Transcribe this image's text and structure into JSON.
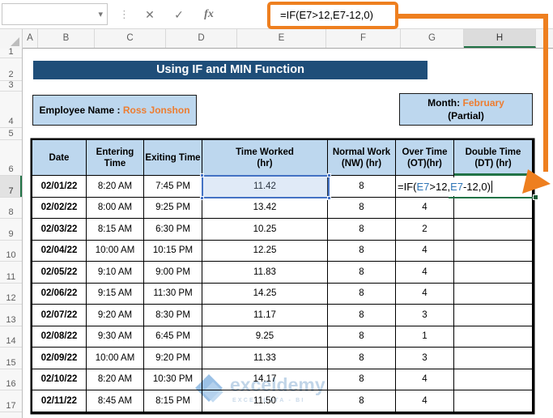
{
  "formula_bar": {
    "name_box_value": "",
    "dropdown_icon": "▾",
    "separator_icon": "⋮",
    "cancel_icon": "✕",
    "enter_icon": "✓",
    "fx_icon": "fx",
    "formula": "=IF(E7>12,E7-12,0)"
  },
  "sheet": {
    "column_letters": [
      "A",
      "B",
      "C",
      "D",
      "E",
      "F",
      "G",
      "H"
    ],
    "active_column": "H",
    "row_numbers": [
      "1",
      "2",
      "3",
      "4",
      "5",
      "6",
      "7",
      "8",
      "9",
      "10",
      "11",
      "12",
      "13",
      "14",
      "15",
      "16",
      "17"
    ],
    "active_row": "7"
  },
  "banner": {
    "title": "Using IF and MIN Function"
  },
  "employee_box": {
    "label": "Employee Name :",
    "value": "Ross Jonshon"
  },
  "month_box": {
    "label": "Month:",
    "value": "February",
    "line2": "(Partial)"
  },
  "table": {
    "headers": [
      "Date",
      "Entering\nTime",
      "Exiting Time",
      "Time Worked\n(hr)",
      "Normal Work\n(NW) (hr)",
      "Over Time\n(OT)(hr)",
      "Double Time\n(DT) (hr)"
    ],
    "rows": [
      [
        "02/01/22",
        "8:20 AM",
        "7:45 PM",
        "11.42",
        "8",
        "",
        ""
      ],
      [
        "02/02/22",
        "8:00 AM",
        "9:25 PM",
        "13.42",
        "8",
        "4",
        ""
      ],
      [
        "02/03/22",
        "8:15 AM",
        "6:30 PM",
        "10.25",
        "8",
        "2",
        ""
      ],
      [
        "02/04/22",
        "10:00 AM",
        "10:15 PM",
        "12.25",
        "8",
        "4",
        ""
      ],
      [
        "02/05/22",
        "9:10 AM",
        "9:00 PM",
        "11.83",
        "8",
        "4",
        ""
      ],
      [
        "02/06/22",
        "9:15 AM",
        "11:30 PM",
        "14.25",
        "8",
        "4",
        ""
      ],
      [
        "02/07/22",
        "9:20 AM",
        "8:30 PM",
        "11.17",
        "8",
        "3",
        ""
      ],
      [
        "02/08/22",
        "9:30 AM",
        "6:45 PM",
        "9.25",
        "8",
        "1",
        ""
      ],
      [
        "02/09/22",
        "10:00 AM",
        "9:20 PM",
        "11.33",
        "8",
        "3",
        ""
      ],
      [
        "02/10/22",
        "8:20 AM",
        "10:30 PM",
        "14.17",
        "8",
        "4",
        ""
      ],
      [
        "02/11/22",
        "8:45 AM",
        "8:15 PM",
        "11.50",
        "8",
        "4",
        ""
      ]
    ]
  },
  "cell_edit": {
    "cell": "H7",
    "segments": [
      {
        "text": "=IF(",
        "color": "black"
      },
      {
        "text": "E7",
        "color": "blue"
      },
      {
        "text": ">12,",
        "color": "black"
      },
      {
        "text": "E7",
        "color": "blue"
      },
      {
        "text": "-12,0)",
        "color": "black"
      }
    ]
  },
  "watermark": {
    "text": "exceldemy",
    "subtext": "EXCEL DATA - BI"
  },
  "colors": {
    "banner_blue": "#1F4E79",
    "header_blue": "#BDD7EE",
    "accent_orange": "#ED7D31",
    "callout_orange": "#EE7F1F",
    "excel_green": "#217346",
    "selection_blue": "#4472C4",
    "reference_blue": "#2E75B6"
  }
}
